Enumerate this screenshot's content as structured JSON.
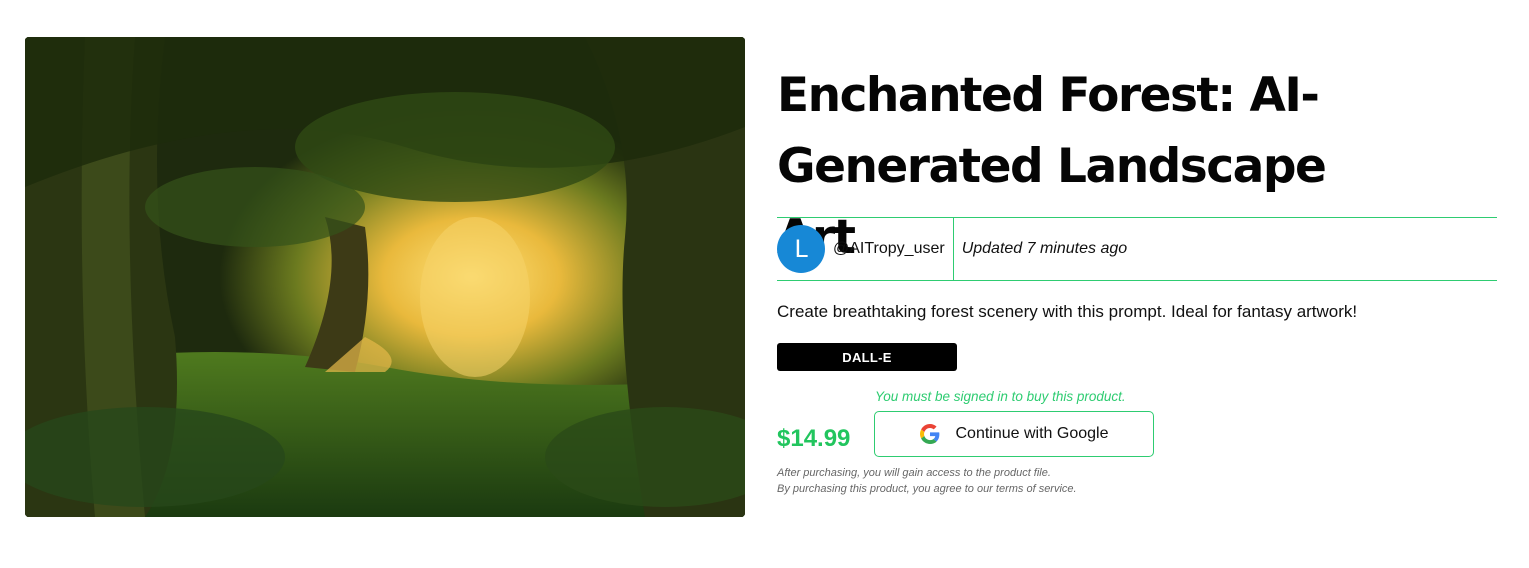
{
  "product": {
    "image_alt": "Enchanted forest with glowing light through trees",
    "title": "Enchanted Forest: AI-Generated Landscape Art",
    "author": {
      "avatar_letter": "L",
      "username": "@AITropy_user",
      "avatar_color": "#1788d6"
    },
    "updated": "Updated 7 minutes ago",
    "description": "Create breathtaking forest scenery with this prompt. Ideal for fantasy artwork!",
    "tag": "DALL-E",
    "price": "$14.99",
    "signin_note": "You must be signed in to buy this product.",
    "google_button_label": "Continue with Google",
    "fineprint_line1": "After purchasing, you will gain access to the product file.",
    "fineprint_line2": "By purchasing this product, you agree to our terms of service."
  },
  "colors": {
    "accent_green": "#2ecc71",
    "price_green": "#22c55e",
    "tag_bg": "#000000"
  }
}
